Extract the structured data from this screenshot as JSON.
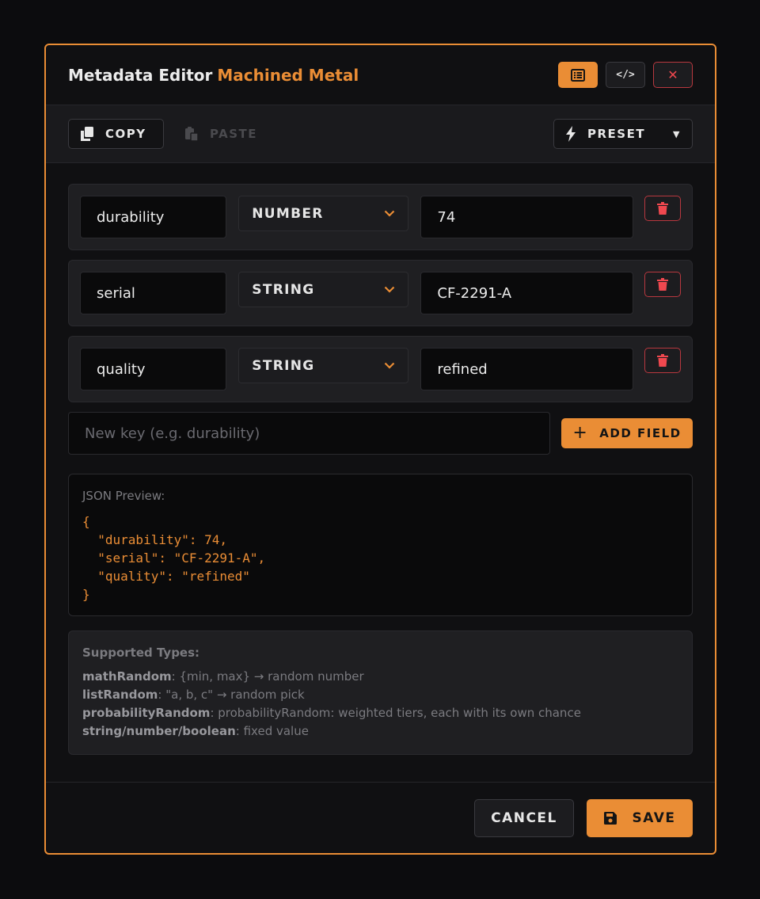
{
  "header": {
    "title": "Metadata Editor",
    "subtitle": "Machined Metal",
    "list_view_icon": "list-icon",
    "code_view_icon": "code-icon",
    "code_glyph": "</>",
    "close_glyph": "✕"
  },
  "toolbar": {
    "copy_label": "COPY",
    "paste_label": "PASTE",
    "preset_label": "PRESET"
  },
  "fields": [
    {
      "key": "durability",
      "type": "NUMBER",
      "value": "74"
    },
    {
      "key": "serial",
      "type": "STRING",
      "value": "CF-2291-A"
    },
    {
      "key": "quality",
      "type": "STRING",
      "value": "refined"
    }
  ],
  "add_field": {
    "placeholder": "New key (e.g. durability)",
    "button_label": "ADD FIELD",
    "plus_glyph": "+"
  },
  "json_preview": {
    "label": "JSON Preview:",
    "code": "{\n  \"durability\": 74,\n  \"serial\": \"CF-2291-A\",\n  \"quality\": \"refined\"\n}"
  },
  "supported_types": {
    "title": "Supported Types:",
    "items": [
      {
        "name": "mathRandom",
        "desc": ": {min, max} → random number"
      },
      {
        "name": "listRandom",
        "desc": ": \"a, b, c\" → random pick"
      },
      {
        "name": "probabilityRandom",
        "desc": ": probabilityRandom: weighted tiers, each with its own chance"
      },
      {
        "name": "string/number/boolean",
        "desc": ": fixed value"
      }
    ]
  },
  "footer": {
    "cancel_label": "CANCEL",
    "save_label": "SAVE"
  },
  "colors": {
    "accent": "#ea8d35",
    "danger": "#f0484f",
    "background": "#101012"
  }
}
